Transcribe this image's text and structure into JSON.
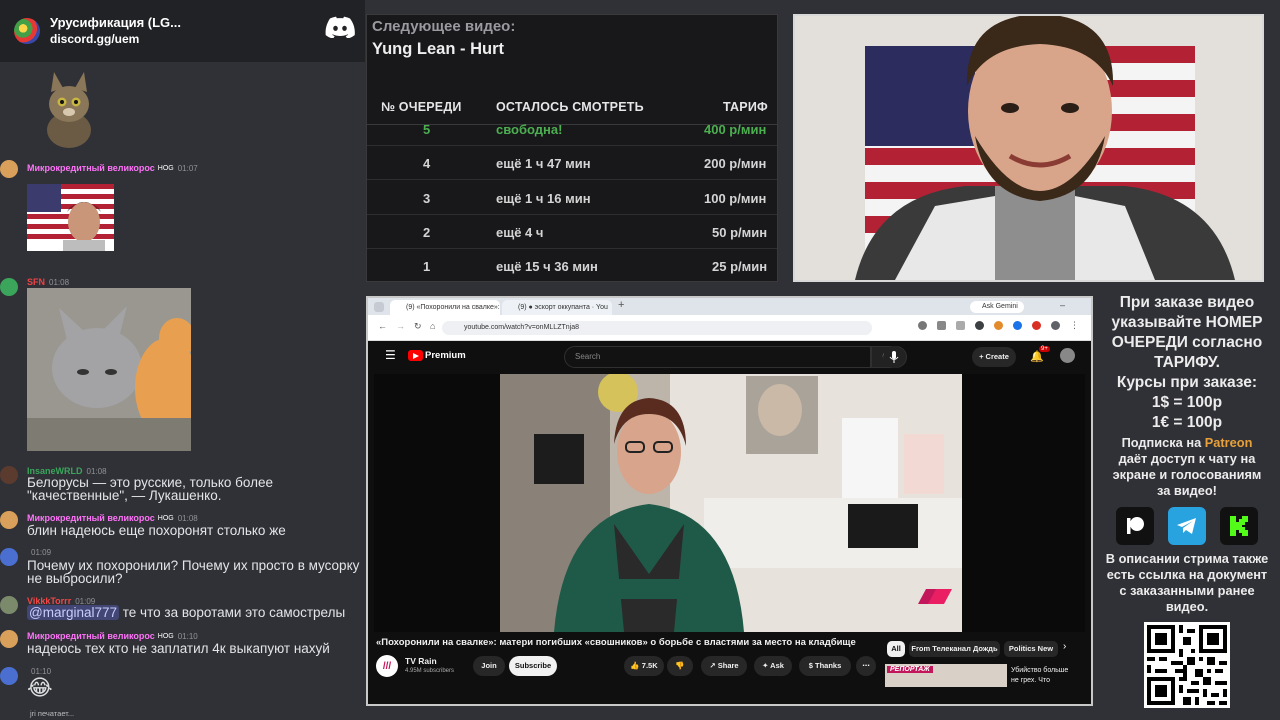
{
  "discord": {
    "server_name": "Урусификация (LG...",
    "invite": "discord.gg/uem",
    "messages": [
      {
        "user": "Микрокредитный великорос",
        "badge": "HOG",
        "time": "01:07",
        "user_color": "#ff73fa"
      },
      {
        "user": "SFN",
        "time": "01:08",
        "user_color": "#ed4245"
      },
      {
        "user": "InsaneWRLD",
        "time": "01:08",
        "user_color": "#3ba55c",
        "text_l1": "Белорусы — это русские, только более",
        "text_l2": "\"качественные\", — Лукашенко."
      },
      {
        "user": "Микрокредитный великорос",
        "badge": "HOG",
        "time": "01:08",
        "user_color": "#ff73fa",
        "text": "блин надеюсь еще похоронят столько же"
      },
      {
        "user": "",
        "time": "01:09",
        "text_l1": "Почему их похоронили? Почему их просто в мусорку",
        "text_l2": "не выбросили?"
      },
      {
        "user": "VikkkTorrr",
        "time": "01:09",
        "user_color": "#f04747",
        "mention": "@marginal777",
        "text": " те что за воротами это самострелы"
      },
      {
        "user": "Микрокредитный великорос",
        "badge": "HOG",
        "time": "01:10",
        "user_color": "#ff73fa",
        "text": "надеюсь тех кто не заплатил 4к выкапуют нахуй"
      },
      {
        "user": "",
        "time": "01:10",
        "emoji": "😂"
      }
    ],
    "typing": "jri печатает..."
  },
  "queue": {
    "next_label": "Следующее видео:",
    "next_title": "Yung Lean - Hurt",
    "headers": {
      "num": "№ ОЧЕРЕДИ",
      "remaining": "ОСТАЛОСЬ СМОТРЕТЬ",
      "tariff": "ТАРИФ"
    },
    "rows": [
      {
        "num": "5",
        "remaining": "свободна!",
        "tariff": "400 р/мин",
        "free": true
      },
      {
        "num": "4",
        "remaining": "ещё 1 ч 47 мин",
        "tariff": "200 р/мин"
      },
      {
        "num": "3",
        "remaining": "ещё 1 ч 16 мин",
        "tariff": "100 р/мин"
      },
      {
        "num": "2",
        "remaining": "ещё 4 ч",
        "tariff": "50 р/мин"
      },
      {
        "num": "1",
        "remaining": "ещё 15 ч 36 мин",
        "tariff": "25 р/мин"
      }
    ]
  },
  "browser": {
    "tab1": "(9) «Похоронили на свалке»: м",
    "tab2": "(9) ● эскорт оккупанта · You",
    "ask_gemini": "Ask Gemini",
    "url": "youtube.com/watch?v=onMLLZTnja8",
    "youtube": {
      "logo_text": "Premium",
      "search_placeholder": "Search",
      "create": "Create",
      "notif_count": "9+",
      "video_title": "«Похоронили на свалке»: матери погибших «свошников» о борьбе с властями за место на кладбище",
      "channel": "TV Rain",
      "subscribers": "4.95M subscribers",
      "join": "Join",
      "subscribe": "Subscribe",
      "likes": "7.5K",
      "share": "Share",
      "ask": "Ask",
      "thanks": "Thanks",
      "chips": [
        "All",
        "From Телеканал Дождь",
        "Politics New"
      ],
      "rec_badge": "РЕПОРТАЖ",
      "rec_title_l1": "Убийство больше",
      "rec_title_l2": "не грех. Что"
    }
  },
  "info": {
    "line1": "При заказе видео",
    "line2": "указывайте НОМЕР",
    "line3": "ОЧЕРЕДИ согласно",
    "line4": "ТАРИФУ.",
    "line5": "Курсы при заказе:",
    "rate_usd": "1$ = 100р",
    "rate_eur": "1€ = 100р",
    "sub_pre": "Подписка на ",
    "sub_link": "Patreon",
    "sub_l2": "даёт доступ к чату на",
    "sub_l3": "экране и голосованиям",
    "sub_l4": "за видео!",
    "desc_l1": "В описании стрима также",
    "desc_l2": "есть ссылка на документ",
    "desc_l3": "с заказанными ранее",
    "desc_l4": "видео."
  }
}
